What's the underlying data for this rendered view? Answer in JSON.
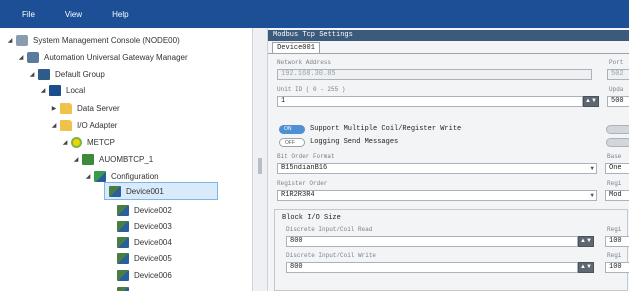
{
  "menu": [
    "File",
    "View",
    "Help"
  ],
  "tree": [
    {
      "label": "System Management Console (NODE00)",
      "icon": "console-icon"
    },
    {
      "label": "Automation Universal Gateway Manager",
      "icon": "gateway-icon"
    },
    {
      "label": "Default Group",
      "icon": "group-icon"
    },
    {
      "label": "Local",
      "icon": "local-icon"
    },
    {
      "label": "Data Server",
      "icon": "folder-icon"
    },
    {
      "label": "I/O Adapter",
      "icon": "folder-icon"
    },
    {
      "label": "METCP",
      "icon": "metcp-icon"
    },
    {
      "label": "AUOMBTCP_1",
      "icon": "adapter-icon"
    },
    {
      "label": "Configuration",
      "icon": "configuration-icon"
    },
    {
      "label": "Device001",
      "icon": "device-icon"
    },
    {
      "label": "Device002",
      "icon": "device-icon"
    },
    {
      "label": "Device003",
      "icon": "device-icon"
    },
    {
      "label": "Device004",
      "icon": "device-icon"
    },
    {
      "label": "Device005",
      "icon": "device-icon"
    },
    {
      "label": "Device006",
      "icon": "device-icon"
    }
  ],
  "panel": {
    "title": "Modbus Tcp Settings",
    "tab": "Device001",
    "network_address_label": "Network Address",
    "network_address_value": "192.168.30.85",
    "port_label": "Port",
    "port_value": "502",
    "unit_id_label": "Unit ID ( 0 - 255 )",
    "unit_id_value": "1",
    "update_label": "Upda",
    "update_value": "500",
    "toggle_on_text": "ON",
    "toggle_off_text": "OFF",
    "support_multiple_label": "Support Multiple Coil/Register Write",
    "logging_label": "Logging Send Messages",
    "bit_order_label": "Bit Order Format",
    "bit_order_value": "B15ndianB16",
    "base_label": "Base",
    "base_value": "One",
    "register_order_label": "Register Order",
    "register_order_value": "R1R2R3R4",
    "register_right_label": "Regi",
    "register_right_value": "Mod",
    "block_size_label": "Block I/O Size",
    "discrete_read_label": "Discrete Input/Coil Read",
    "discrete_read_value": "800",
    "discrete_write_label": "Discrete Input/Coil Write",
    "discrete_write_value": "800",
    "reg_right_1_label": "Regi",
    "reg_right_1_value": "100",
    "reg_right_2_label": "Regi",
    "reg_right_2_value": "100"
  }
}
